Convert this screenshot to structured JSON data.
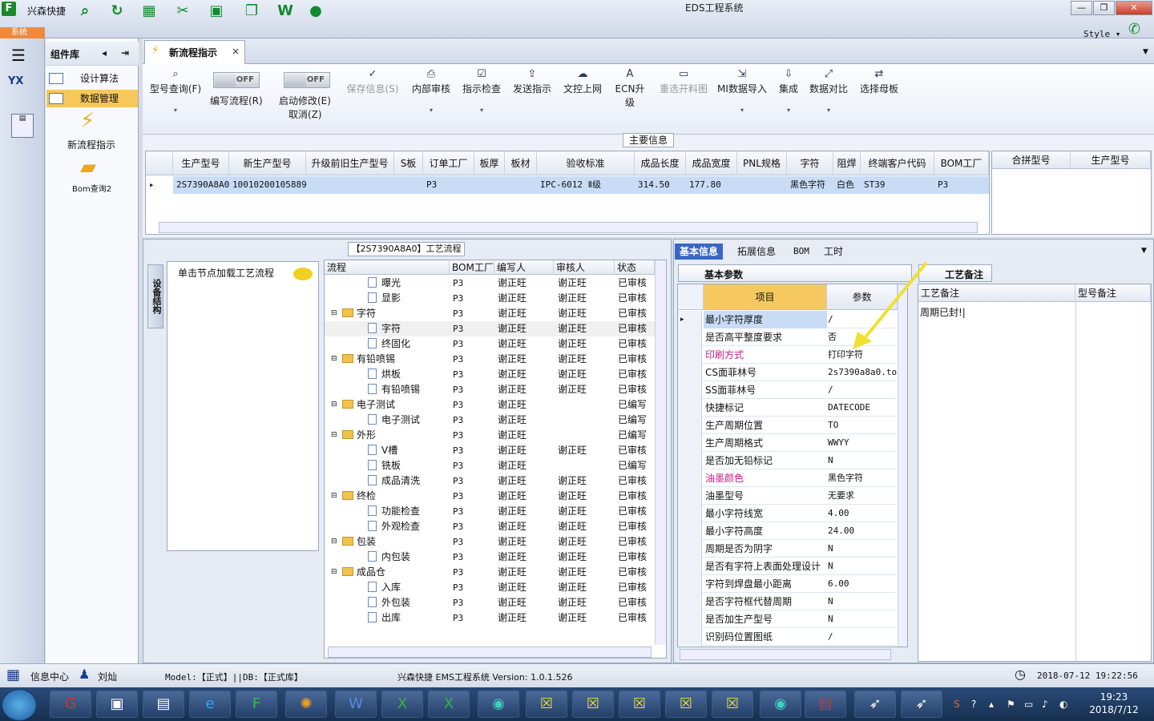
{
  "app": {
    "name": "兴森快捷",
    "system_title": "EDS工程系统",
    "sys_tab": "系统",
    "style_label": "Style"
  },
  "component_lib": {
    "title": "组件库",
    "items": [
      "设计算法",
      "数据管理",
      "新流程指示",
      "Bom查询2"
    ]
  },
  "left_nav": {
    "yx": "YX"
  },
  "tab": {
    "label": "新流程指示"
  },
  "ribbon": {
    "buttons": [
      "型号查询(F)",
      "保存信息(S)",
      "内部审核",
      "指示检查",
      "发送指示",
      "文控上网",
      "ECN升级",
      "重选开料图",
      "MI数据导入",
      "集成",
      "数据对比",
      "选择母板"
    ],
    "toggle1": {
      "state": "OFF",
      "label": "编写流程(R)"
    },
    "toggle2": {
      "state": "OFF",
      "label": "启动修改(E)",
      "sub": "取消(Z)"
    }
  },
  "main_info": {
    "label": "主要信息",
    "headers": [
      "生产型号",
      "新生产型号",
      "升级前旧生产型号",
      "S板",
      "订单工厂",
      "板厚",
      "板材",
      "验收标准",
      "成品长度",
      "成品宽度",
      "PNL规格",
      "字符",
      "阻焊",
      "终端客户代码",
      "BOM工厂"
    ],
    "row": [
      "2S7390A8A0",
      "10010200105889",
      "",
      "",
      "P3",
      "",
      "",
      "IPC-6012 Ⅱ级",
      "314.50",
      "177.80",
      "",
      "黑色字符",
      "白色",
      "ST39",
      "P3"
    ],
    "side_headers": [
      "合拼型号",
      "生产型号"
    ]
  },
  "flow": {
    "label": "【2S7390A8A0】工艺流程",
    "side_tab": "设备结构",
    "node_hint": "单击节点加载工艺流程",
    "columns": [
      "流程",
      "BOM工厂",
      "编写人",
      "审核人",
      "状态"
    ],
    "rows": [
      {
        "level": 2,
        "name": "曝光",
        "bom": "P3",
        "writer": "谢正旺",
        "auditor": "谢正旺",
        "status": "已审核"
      },
      {
        "level": 2,
        "name": "显影",
        "bom": "P3",
        "writer": "谢正旺",
        "auditor": "谢正旺",
        "status": "已审核"
      },
      {
        "level": 1,
        "name": "字符",
        "bom": "P3",
        "writer": "谢正旺",
        "auditor": "谢正旺",
        "status": "已审核"
      },
      {
        "level": 2,
        "name": "字符",
        "bom": "P3",
        "writer": "谢正旺",
        "auditor": "谢正旺",
        "status": "已审核",
        "selected": true
      },
      {
        "level": 2,
        "name": "终固化",
        "bom": "P3",
        "writer": "谢正旺",
        "auditor": "谢正旺",
        "status": "已审核"
      },
      {
        "level": 1,
        "name": "有铅喷锡",
        "bom": "P3",
        "writer": "谢正旺",
        "auditor": "谢正旺",
        "status": "已审核"
      },
      {
        "level": 2,
        "name": "烘板",
        "bom": "P3",
        "writer": "谢正旺",
        "auditor": "谢正旺",
        "status": "已审核"
      },
      {
        "level": 2,
        "name": "有铅喷锡",
        "bom": "P3",
        "writer": "谢正旺",
        "auditor": "谢正旺",
        "status": "已审核"
      },
      {
        "level": 1,
        "name": "电子测试",
        "bom": "P3",
        "writer": "谢正旺",
        "auditor": "",
        "status": "已编写"
      },
      {
        "level": 2,
        "name": "电子测试",
        "bom": "P3",
        "writer": "谢正旺",
        "auditor": "",
        "status": "已编写"
      },
      {
        "level": 1,
        "name": "外形",
        "bom": "P3",
        "writer": "谢正旺",
        "auditor": "",
        "status": "已编写"
      },
      {
        "level": 2,
        "name": "V槽",
        "bom": "P3",
        "writer": "谢正旺",
        "auditor": "谢正旺",
        "status": "已审核"
      },
      {
        "level": 2,
        "name": "铣板",
        "bom": "P3",
        "writer": "谢正旺",
        "auditor": "",
        "status": "已编写"
      },
      {
        "level": 2,
        "name": "成品清洗",
        "bom": "P3",
        "writer": "谢正旺",
        "auditor": "谢正旺",
        "status": "已审核"
      },
      {
        "level": 1,
        "name": "终检",
        "bom": "P3",
        "writer": "谢正旺",
        "auditor": "谢正旺",
        "status": "已审核"
      },
      {
        "level": 2,
        "name": "功能检查",
        "bom": "P3",
        "writer": "谢正旺",
        "auditor": "谢正旺",
        "status": "已审核"
      },
      {
        "level": 2,
        "name": "外观检查",
        "bom": "P3",
        "writer": "谢正旺",
        "auditor": "谢正旺",
        "status": "已审核"
      },
      {
        "level": 1,
        "name": "包装",
        "bom": "P3",
        "writer": "谢正旺",
        "auditor": "谢正旺",
        "status": "已审核"
      },
      {
        "level": 2,
        "name": "内包装",
        "bom": "P3",
        "writer": "谢正旺",
        "auditor": "谢正旺",
        "status": "已审核"
      },
      {
        "level": 1,
        "name": "成品仓",
        "bom": "P3",
        "writer": "谢正旺",
        "auditor": "谢正旺",
        "status": "已审核"
      },
      {
        "level": 2,
        "name": "入库",
        "bom": "P3",
        "writer": "谢正旺",
        "auditor": "谢正旺",
        "status": "已审核"
      },
      {
        "level": 2,
        "name": "外包装",
        "bom": "P3",
        "writer": "谢正旺",
        "auditor": "谢正旺",
        "status": "已审核"
      },
      {
        "level": 2,
        "name": "出库",
        "bom": "P3",
        "writer": "谢正旺",
        "auditor": "谢正旺",
        "status": "已审核"
      }
    ]
  },
  "basic": {
    "tabs": [
      "基本信息",
      "拓展信息",
      "BOM",
      "工时"
    ],
    "subtab": "基本参数",
    "notes_tab": "工艺备注",
    "col_item": "项目",
    "col_param": "参数",
    "params": [
      {
        "k": "最小字符厚度",
        "v": "/"
      },
      {
        "k": "是否高平整度要求",
        "v": "否"
      },
      {
        "k": "印刷方式",
        "v": "打印字符",
        "pink": true
      },
      {
        "k": "CS面菲林号",
        "v": "2s7390a8a0.to"
      },
      {
        "k": "SS面菲林号",
        "v": "/"
      },
      {
        "k": "快捷标记",
        "v": "DATECODE"
      },
      {
        "k": "生产周期位置",
        "v": "TO"
      },
      {
        "k": "生产周期格式",
        "v": "WWYY"
      },
      {
        "k": "是否加无铅标记",
        "v": "N"
      },
      {
        "k": "油墨颜色",
        "v": "黑色字符",
        "pink": true
      },
      {
        "k": "油墨型号",
        "v": "无要求"
      },
      {
        "k": "最小字符线宽",
        "v": "4.00"
      },
      {
        "k": "最小字符高度",
        "v": "24.00"
      },
      {
        "k": "周期是否为阴字",
        "v": "N"
      },
      {
        "k": "是否有字符上表面处理设计",
        "v": "N"
      },
      {
        "k": "字符到焊盘最小距离",
        "v": "6.00"
      },
      {
        "k": "是否字符框代替周期",
        "v": "N"
      },
      {
        "k": "是否加生产型号",
        "v": "N"
      },
      {
        "k": "识别码位置图纸",
        "v": "/"
      }
    ],
    "notes_cols": [
      "工艺备注",
      "型号备注"
    ],
    "note_text": "周期已封!|",
    "highlight_color": "#f0e030"
  },
  "status": {
    "info": "信息中心",
    "user": "刘灿",
    "model": "Model:【正式】||DB:【正式库】",
    "version": "兴森快捷 EMS工程系统 Version: 1.0.1.526",
    "datetime": "2018-07-12 19:22:56"
  },
  "taskbar": {
    "time": "19:23",
    "date": "2018/7/12"
  }
}
